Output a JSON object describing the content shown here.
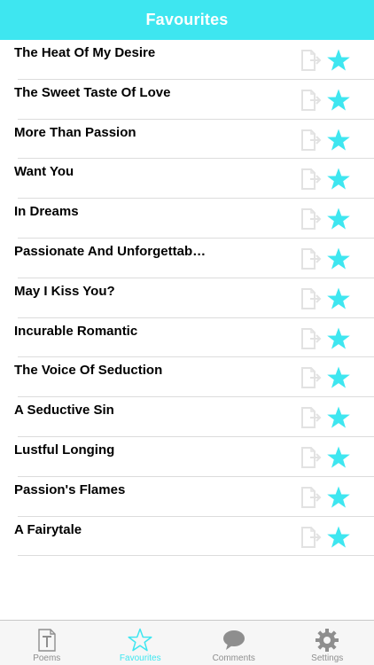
{
  "colors": {
    "accent": "#3ee6f0",
    "navbar_bg": "#3ee6f0",
    "icon_inactive": "#8e8e8e",
    "doc_icon": "#e2e2e2"
  },
  "navbar": {
    "title": "Favourites"
  },
  "favourites": [
    {
      "title": "The Heat Of My Desire"
    },
    {
      "title": "The Sweet Taste Of Love"
    },
    {
      "title": "More Than Passion"
    },
    {
      "title": "Want You"
    },
    {
      "title": "In Dreams"
    },
    {
      "title": "Passionate And Unforgettab…"
    },
    {
      "title": "May I Kiss You?"
    },
    {
      "title": "Incurable Romantic"
    },
    {
      "title": "The Voice Of Seduction"
    },
    {
      "title": "A Seductive Sin"
    },
    {
      "title": "Lustful Longing"
    },
    {
      "title": "Passion's Flames"
    },
    {
      "title": "A Fairytale"
    }
  ],
  "tabbar": {
    "items": [
      {
        "label": "Poems",
        "icon": "poems-document-icon",
        "active": false
      },
      {
        "label": "Favourites",
        "icon": "star-outline-icon",
        "active": true
      },
      {
        "label": "Comments",
        "icon": "speech-bubble-icon",
        "active": false
      },
      {
        "label": "Settings",
        "icon": "gear-icon",
        "active": false
      }
    ]
  }
}
